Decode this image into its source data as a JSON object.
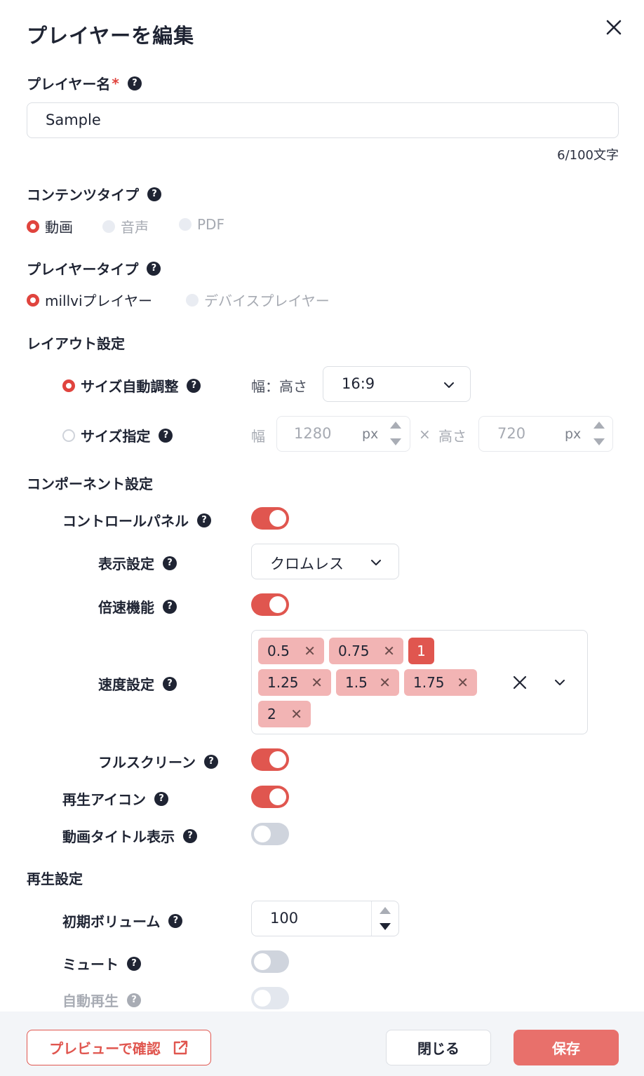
{
  "dialog": {
    "title": "プレイヤーを編集"
  },
  "player_name": {
    "label": "プレイヤー名",
    "required_mark": "*",
    "value": "Sample",
    "counter": "6/100文字"
  },
  "content_type": {
    "label": "コンテンツタイプ",
    "options": [
      {
        "label": "動画",
        "selected": true,
        "enabled": true
      },
      {
        "label": "音声",
        "selected": false,
        "enabled": false
      },
      {
        "label": "PDF",
        "selected": false,
        "enabled": false
      }
    ]
  },
  "player_type": {
    "label": "プレイヤータイプ",
    "options": [
      {
        "label": "millviプレイヤー",
        "selected": true,
        "enabled": true
      },
      {
        "label": "デバイスプレイヤー",
        "selected": false,
        "enabled": false
      }
    ]
  },
  "layout": {
    "heading": "レイアウト設定",
    "auto_size": {
      "label": "サイズ自動調整",
      "selected": true,
      "ratio_label": "幅：高さ",
      "ratio_value": "16:9"
    },
    "fixed_size": {
      "label": "サイズ指定",
      "selected": false,
      "width_label": "幅",
      "width_value": "1280",
      "unit": "px",
      "times": "×",
      "height_label": "高さ",
      "height_value": "720"
    }
  },
  "components": {
    "heading": "コンポーネント設定",
    "control_panel": {
      "label": "コントロールパネル",
      "on": true
    },
    "display": {
      "label": "表示設定",
      "value": "クロムレス"
    },
    "speed_feature": {
      "label": "倍速機能",
      "on": true
    },
    "speed_settings": {
      "label": "速度設定",
      "tags": [
        {
          "label": "0.5",
          "default": false
        },
        {
          "label": "0.75",
          "default": false
        },
        {
          "label": "1",
          "default": true
        },
        {
          "label": "1.25",
          "default": false
        },
        {
          "label": "1.5",
          "default": false
        },
        {
          "label": "1.75",
          "default": false
        },
        {
          "label": "2",
          "default": false
        }
      ]
    },
    "fullscreen": {
      "label": "フルスクリーン",
      "on": true
    },
    "play_icon": {
      "label": "再生アイコン",
      "on": true
    },
    "video_title": {
      "label": "動画タイトル表示",
      "on": false
    }
  },
  "playback": {
    "heading": "再生設定",
    "initial_volume": {
      "label": "初期ボリューム",
      "value": "100"
    },
    "mute": {
      "label": "ミュート",
      "on": false
    },
    "autoplay": {
      "label": "自動再生",
      "on": false
    }
  },
  "footer": {
    "preview_label": "プレビューで確認",
    "close_label": "閉じる",
    "save_label": "保存"
  },
  "colors": {
    "accent": "#e0564f",
    "primary_button": "#e8706b",
    "tag_bg": "#f2b4b4",
    "footer_bg": "#f3f5f8"
  },
  "icons": [
    "close-icon",
    "help-icon",
    "chevron-down-icon",
    "external-link-icon",
    "clear-icon"
  ]
}
